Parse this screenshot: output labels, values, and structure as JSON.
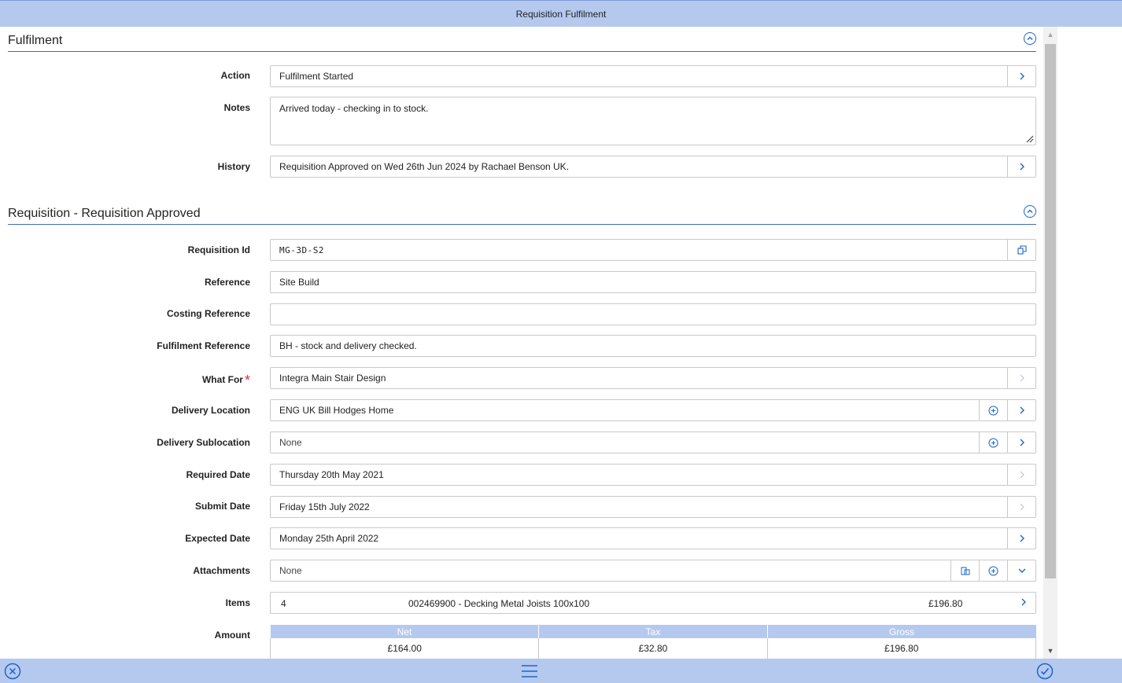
{
  "window": {
    "title": "Requisition Fulfilment"
  },
  "fulfilment": {
    "title": "Fulfilment",
    "collapse_icon": "chevron-up-circle-icon",
    "action": {
      "label": "Action",
      "value": "Fulfilment Started"
    },
    "notes": {
      "label": "Notes",
      "value": "Arrived today - checking in to stock."
    },
    "history": {
      "label": "History",
      "value": "Requisition Approved on Wed 26th Jun 2024 by Rachael Benson UK."
    }
  },
  "requisition": {
    "title": "Requisition - Requisition Approved",
    "collapse_icon": "chevron-up-circle-icon",
    "requisition_id": {
      "label": "Requisition Id",
      "value": "MG-3D-S2"
    },
    "reference": {
      "label": "Reference",
      "value": "Site Build"
    },
    "costing_reference": {
      "label": "Costing Reference",
      "value": ""
    },
    "fulfilment_reference": {
      "label": "Fulfilment Reference",
      "value": "BH - stock and delivery checked."
    },
    "what_for": {
      "label": "What For",
      "required_mark": "*",
      "value": "Integra Main Stair Design"
    },
    "delivery_location": {
      "label": "Delivery Location",
      "value": "ENG UK  Bill Hodges Home"
    },
    "delivery_sublocation": {
      "label": "Delivery Sublocation",
      "value": "None"
    },
    "required_date": {
      "label": "Required Date",
      "value": "Thursday 20th May 2021"
    },
    "submit_date": {
      "label": "Submit Date",
      "value": "Friday 15th July 2022"
    },
    "expected_date": {
      "label": "Expected Date",
      "value": "Monday 25th April 2022"
    },
    "attachments": {
      "label": "Attachments",
      "value": "None"
    },
    "items": {
      "label": "Items",
      "count": "4",
      "description": "002469900 - Decking Metal Joists 100x100",
      "total": "£196.80"
    },
    "amount": {
      "label": "Amount",
      "headers": [
        "Net",
        "Tax",
        "Gross"
      ],
      "values": [
        "£164.00",
        "£32.80",
        "£196.80"
      ]
    }
  },
  "bottom_bar": {
    "cancel_icon": "close-circle-icon",
    "menu_icon": "hamburger-menu-icon",
    "confirm_icon": "check-circle-icon"
  },
  "colors": {
    "accent": "#1a66c8",
    "bar": "#b5c9ef",
    "required": "#e0303a"
  }
}
